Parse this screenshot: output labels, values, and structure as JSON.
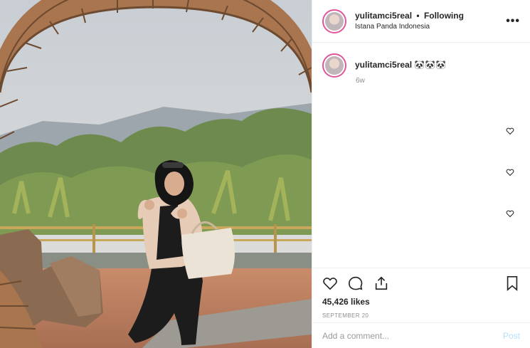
{
  "header": {
    "username": "yulitamci5real",
    "separator": "•",
    "follow_status": "Following",
    "location": "Istana Panda Indonesia",
    "more_label": "•••"
  },
  "caption": {
    "username": "yulitamci5real",
    "emoji": "🐼🐼🐼",
    "time_ago": "6w"
  },
  "actions": {
    "likes": "45,426 likes",
    "date": "September 20"
  },
  "comment": {
    "placeholder": "Add a comment...",
    "post_label": "Post"
  },
  "icons": [
    "heart-icon",
    "comment-icon",
    "share-icon",
    "bookmark-icon",
    "more-icon"
  ],
  "colors": {
    "story_ring": "#e0559b",
    "post_button": "#b2dffc",
    "meta_gray": "#8e8e8e"
  }
}
